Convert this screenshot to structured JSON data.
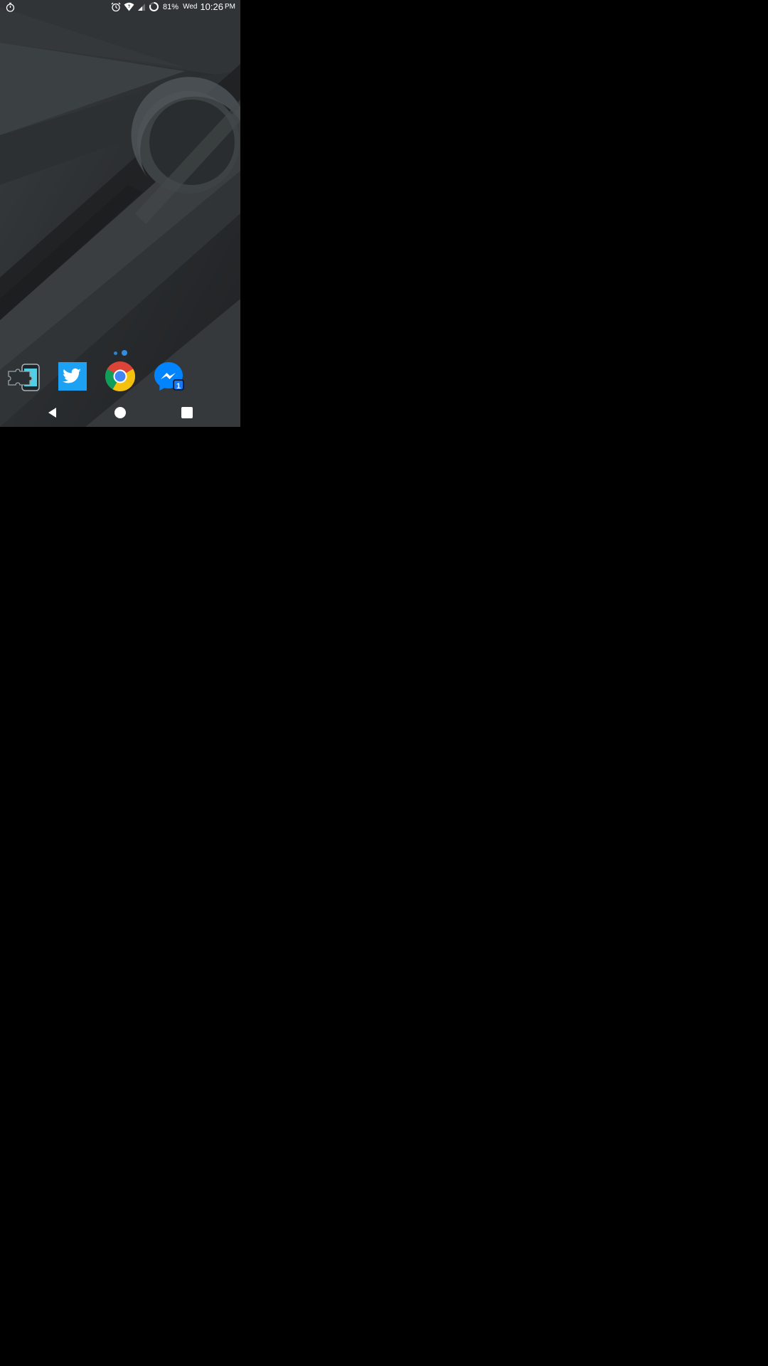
{
  "statusbar": {
    "left_icon": "stopwatch-icon",
    "icons": [
      "alarm-icon",
      "wifi-icon",
      "signal-icon",
      "battery-ring-icon"
    ],
    "battery_percent": "81%",
    "day": "Wed",
    "time": "10:26",
    "ampm": "PM"
  },
  "home": {
    "page_indicator": {
      "count": 2,
      "active_index": 1
    },
    "dock": [
      {
        "name": "app-icon-puzzle",
        "icon": "puzzle-phone-icon"
      },
      {
        "name": "twitter-app",
        "icon": "twitter-icon"
      },
      {
        "name": "chrome-app",
        "icon": "chrome-icon"
      },
      {
        "name": "messenger-app",
        "icon": "messenger-icon",
        "badge": "1"
      }
    ]
  },
  "navbar": {
    "buttons": [
      "back-icon",
      "home-icon",
      "recents-icon"
    ]
  },
  "colors": {
    "accent": "#2f8ee0",
    "twitter": "#1da1f2",
    "messenger": "#0084ff",
    "wallpaper_base": "#2a2d2f"
  }
}
